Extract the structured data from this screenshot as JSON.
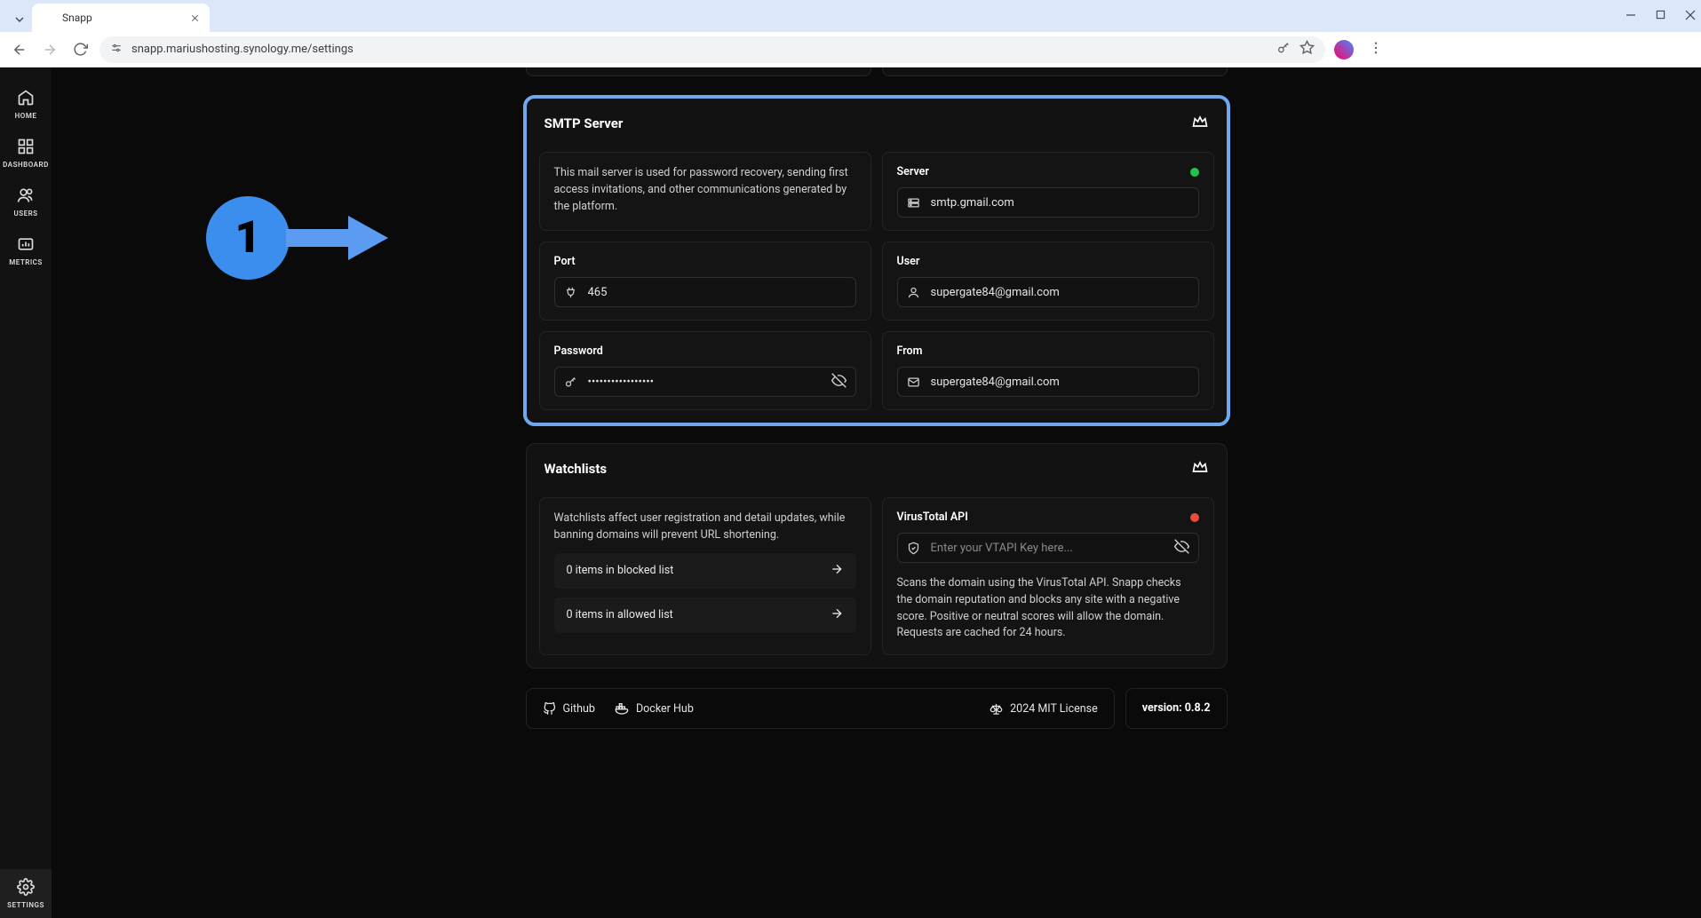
{
  "browser": {
    "tab_title": "Snapp",
    "url": "snapp.mariushosting.synology.me/settings"
  },
  "sidebar": {
    "items": [
      {
        "label": "HOME"
      },
      {
        "label": "DASHBOARD"
      },
      {
        "label": "USERS"
      },
      {
        "label": "METRICS"
      },
      {
        "label": "SETTINGS"
      }
    ]
  },
  "smtp": {
    "title": "SMTP Server",
    "info": "This mail server is used for password recovery, sending first access invitations, and other communications generated by the platform.",
    "server_label": "Server",
    "server_value": "smtp.gmail.com",
    "port_label": "Port",
    "port_value": "465",
    "user_label": "User",
    "user_value": "supergate84@gmail.com",
    "password_label": "Password",
    "password_value": "•••••••••••••••••",
    "from_label": "From",
    "from_value": "supergate84@gmail.com"
  },
  "watch": {
    "title": "Watchlists",
    "info": "Watchlists affect user registration and detail updates, while banning domains will prevent URL shortening.",
    "blocked": "0 items in blocked list",
    "allowed": "0 items in allowed list",
    "vt_label": "VirusTotal API",
    "vt_placeholder": "Enter your VTAPI Key here...",
    "vt_desc": "Scans the domain using the VirusTotal API. Snapp checks the domain reputation and blocks any site with a negative score. Positive or neutral scores will allow the domain. Requests are cached for 24 hours."
  },
  "footer": {
    "github": "Github",
    "docker": "Docker Hub",
    "license": "2024 MIT License",
    "version": "version: 0.8.2"
  },
  "annotation": {
    "number": "1"
  }
}
